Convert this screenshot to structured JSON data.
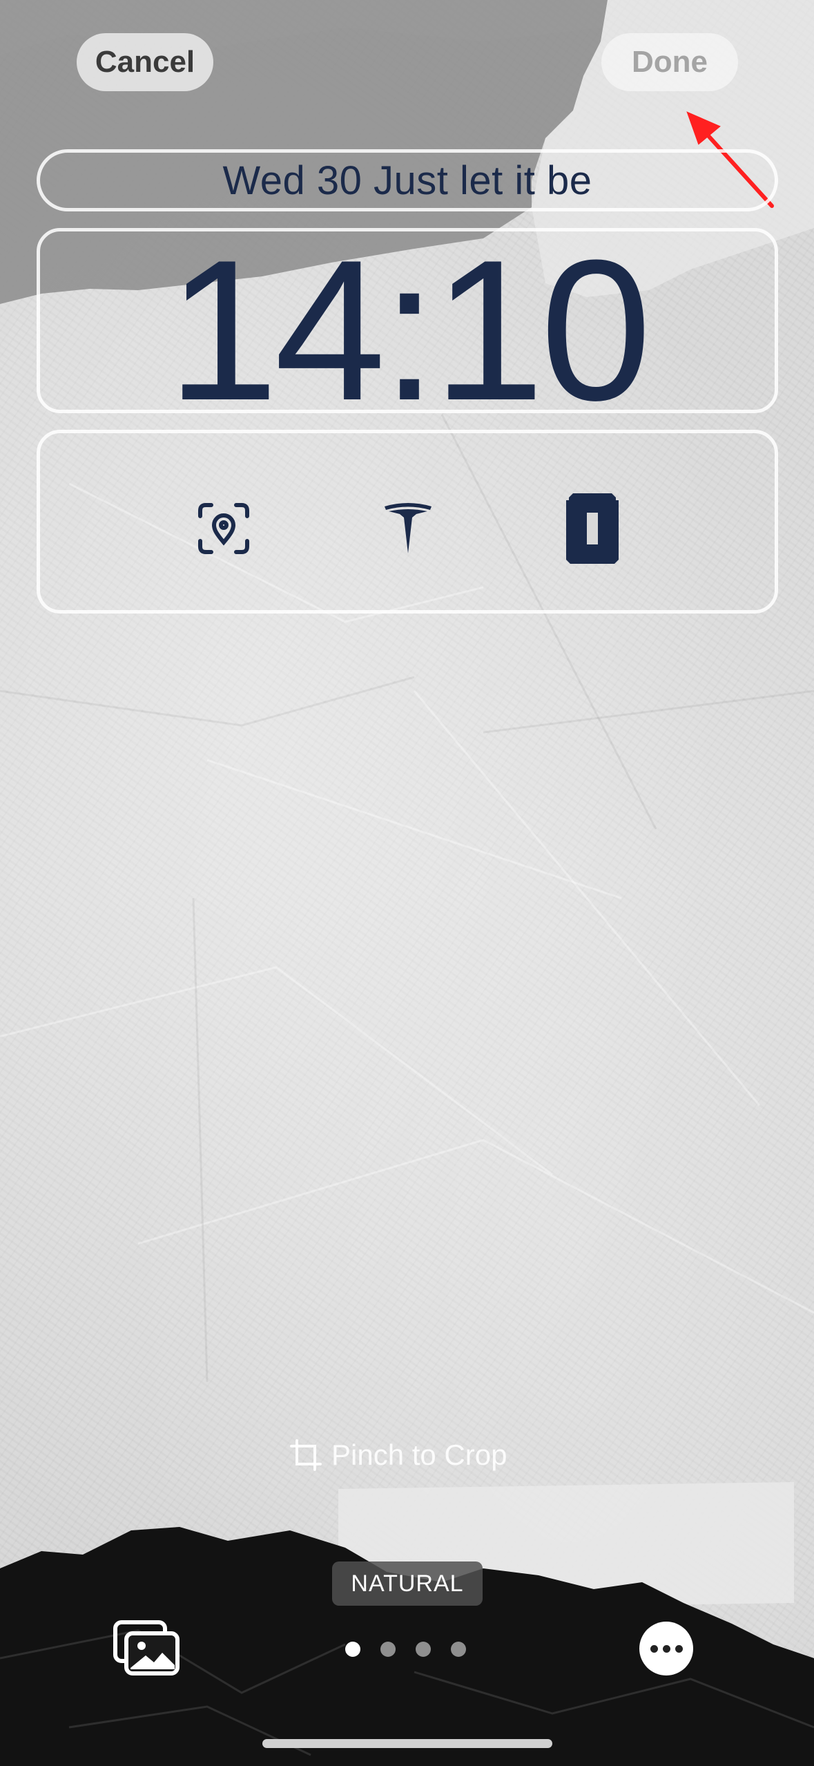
{
  "header": {
    "cancel_label": "Cancel",
    "done_label": "Done"
  },
  "lock_screen": {
    "date_line": "Wed 30  Just let it be",
    "time": "14:10",
    "widgets": [
      {
        "icon": "location-scan-icon"
      },
      {
        "icon": "tesla-logo-icon"
      },
      {
        "icon": "battery-icon"
      }
    ]
  },
  "editor": {
    "hint": "Pinch to Crop",
    "style_label": "NATURAL",
    "page_count": 4,
    "active_page": 1
  },
  "colors": {
    "text_dark_navy": "#1b2a4a",
    "annotation_arrow": "#ff2020"
  }
}
